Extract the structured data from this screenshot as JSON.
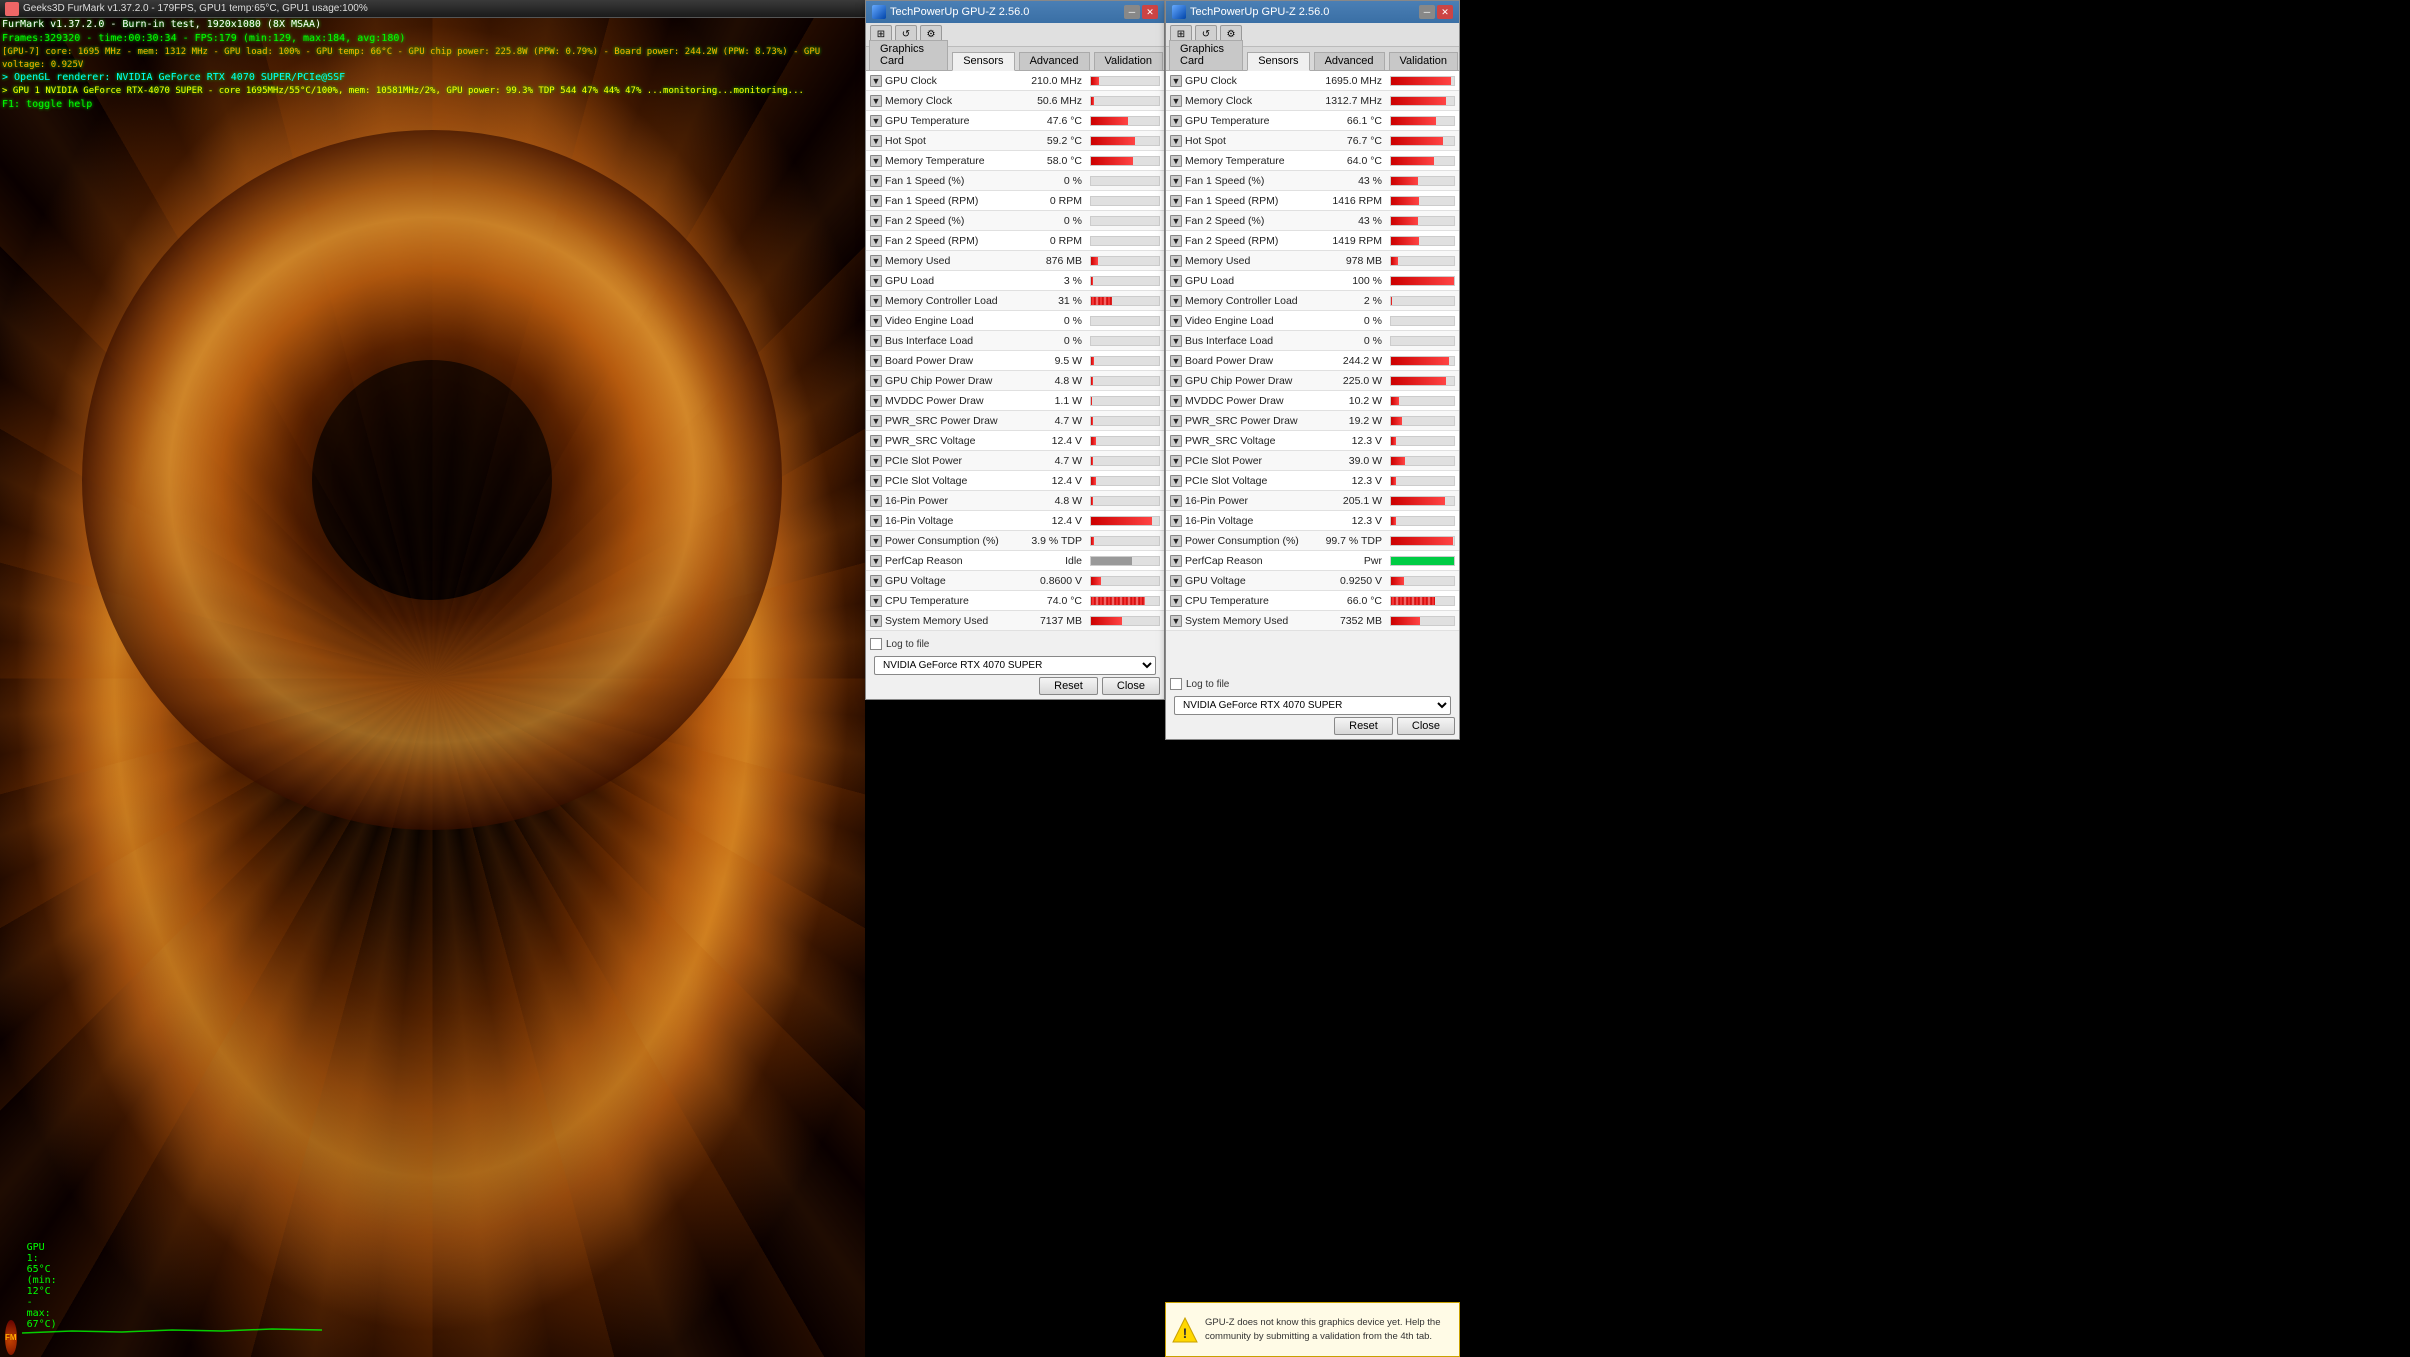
{
  "furmark": {
    "title": "Geeks3D FurMark v1.37.2.0 - 179FPS, GPU1 temp:65°C, GPU1 usage:100%",
    "line1": "FurMark v1.37.2.0 - Burn-in test, 1920x1080 (8X MSAA)",
    "line2": "Frames:329320 - time:00:30:34 - FPS:179 (min:129, max:184, avg:180)",
    "line3": "[GPU-7] core: 1695 MHz - mem: 1312 MHz - GPU load: 100% - GPU temp: 66°C - GPU chip power: 225.8W (PPW: 0.79%) - Board power: 244.2W (PPW: 8.73%) - GPU voltage: 0.925V",
    "line4": "> OpenGL renderer: NVIDIA GeForce RTX 4070 SUPER/PCIe@SSF",
    "line5": "> GPU 1 NVIDIA GeForce RTX-4070 SUPER - core 1695MHz/55°C/100%, mem: 10581MHz/2%, GPU power: 99.3% TDP 544 47% 44% 47% ...monitoring...monitoring...",
    "line6": "F1: toggle help",
    "temp_text": "GPU 1: 65°C (min: 12°C - max: 67°C)"
  },
  "gpuz_left": {
    "title": "TechPowerUp GPU-Z 2.56.0",
    "tabs": [
      "Graphics Card",
      "Sensors",
      "Advanced",
      "Validation"
    ],
    "active_tab": "Sensors",
    "sensors": [
      {
        "name": "GPU Clock",
        "value": "210.0 MHz",
        "bar_pct": 12,
        "bar_type": "red"
      },
      {
        "name": "Memory Clock",
        "value": "50.6 MHz",
        "bar_pct": 4,
        "bar_type": "red"
      },
      {
        "name": "GPU Temperature",
        "value": "47.6 °C",
        "bar_pct": 55,
        "bar_type": "red"
      },
      {
        "name": "Hot Spot",
        "value": "59.2 °C",
        "bar_pct": 65,
        "bar_type": "red"
      },
      {
        "name": "Memory Temperature",
        "value": "58.0 °C",
        "bar_pct": 62,
        "bar_type": "red"
      },
      {
        "name": "Fan 1 Speed (%)",
        "value": "0 %",
        "bar_pct": 0,
        "bar_type": "red"
      },
      {
        "name": "Fan 1 Speed (RPM)",
        "value": "0 RPM",
        "bar_pct": 0,
        "bar_type": "red"
      },
      {
        "name": "Fan 2 Speed (%)",
        "value": "0 %",
        "bar_pct": 0,
        "bar_type": "red"
      },
      {
        "name": "Fan 2 Speed (RPM)",
        "value": "0 RPM",
        "bar_pct": 0,
        "bar_type": "red"
      },
      {
        "name": "Memory Used",
        "value": "876 MB",
        "bar_pct": 10,
        "bar_type": "red"
      },
      {
        "name": "GPU Load",
        "value": "3 %",
        "bar_pct": 3,
        "bar_type": "red"
      },
      {
        "name": "Memory Controller Load",
        "value": "31 %",
        "bar_pct": 31,
        "bar_type": "noise"
      },
      {
        "name": "Video Engine Load",
        "value": "0 %",
        "bar_pct": 0,
        "bar_type": "red"
      },
      {
        "name": "Bus Interface Load",
        "value": "0 %",
        "bar_pct": 0,
        "bar_type": "red"
      },
      {
        "name": "Board Power Draw",
        "value": "9.5 W",
        "bar_pct": 4,
        "bar_type": "red"
      },
      {
        "name": "GPU Chip Power Draw",
        "value": "4.8 W",
        "bar_pct": 3,
        "bar_type": "red"
      },
      {
        "name": "MVDDC Power Draw",
        "value": "1.1 W",
        "bar_pct": 1,
        "bar_type": "red"
      },
      {
        "name": "PWR_SRC Power Draw",
        "value": "4.7 W",
        "bar_pct": 3,
        "bar_type": "red"
      },
      {
        "name": "PWR_SRC Voltage",
        "value": "12.4 V",
        "bar_pct": 8,
        "bar_type": "red"
      },
      {
        "name": "PCIe Slot Power",
        "value": "4.7 W",
        "bar_pct": 3,
        "bar_type": "red"
      },
      {
        "name": "PCIe Slot Voltage",
        "value": "12.4 V",
        "bar_pct": 8,
        "bar_type": "red"
      },
      {
        "name": "16-Pin Power",
        "value": "4.8 W",
        "bar_pct": 3,
        "bar_type": "red"
      },
      {
        "name": "16-Pin Voltage",
        "value": "12.4 V",
        "bar_pct": 90,
        "bar_type": "red"
      },
      {
        "name": "Power Consumption (%)",
        "value": "3.9 % TDP",
        "bar_pct": 4,
        "bar_type": "red"
      },
      {
        "name": "PerfCap Reason",
        "value": "Idle",
        "bar_pct": 60,
        "bar_type": "gray"
      },
      {
        "name": "GPU Voltage",
        "value": "0.8600 V",
        "bar_pct": 15,
        "bar_type": "red"
      },
      {
        "name": "CPU Temperature",
        "value": "74.0 °C",
        "bar_pct": 80,
        "bar_type": "noise"
      },
      {
        "name": "System Memory Used",
        "value": "7137 MB",
        "bar_pct": 45,
        "bar_type": "red"
      }
    ],
    "log_label": "Log to file",
    "btn_reset": "Reset",
    "btn_close": "Close",
    "dropdown": "NVIDIA GeForce RTX 4070 SUPER"
  },
  "gpuz_right": {
    "title": "TechPowerUp GPU-Z 2.56.0",
    "tabs": [
      "Graphics Card",
      "Sensors",
      "Advanced",
      "Validation"
    ],
    "active_tab": "Sensors",
    "sensors": [
      {
        "name": "GPU Clock",
        "value": "1695.0 MHz",
        "bar_pct": 95,
        "bar_type": "red"
      },
      {
        "name": "Memory Clock",
        "value": "1312.7 MHz",
        "bar_pct": 88,
        "bar_type": "red"
      },
      {
        "name": "GPU Temperature",
        "value": "66.1 °C",
        "bar_pct": 72,
        "bar_type": "red"
      },
      {
        "name": "Hot Spot",
        "value": "76.7 °C",
        "bar_pct": 82,
        "bar_type": "red"
      },
      {
        "name": "Memory Temperature",
        "value": "64.0 °C",
        "bar_pct": 68,
        "bar_type": "red"
      },
      {
        "name": "Fan 1 Speed (%)",
        "value": "43 %",
        "bar_pct": 43,
        "bar_type": "red"
      },
      {
        "name": "Fan 1 Speed (RPM)",
        "value": "1416 RPM",
        "bar_pct": 45,
        "bar_type": "red"
      },
      {
        "name": "Fan 2 Speed (%)",
        "value": "43 %",
        "bar_pct": 43,
        "bar_type": "red"
      },
      {
        "name": "Fan 2 Speed (RPM)",
        "value": "1419 RPM",
        "bar_pct": 45,
        "bar_type": "red"
      },
      {
        "name": "Memory Used",
        "value": "978 MB",
        "bar_pct": 11,
        "bar_type": "red"
      },
      {
        "name": "GPU Load",
        "value": "100 %",
        "bar_pct": 100,
        "bar_type": "red"
      },
      {
        "name": "Memory Controller Load",
        "value": "2 %",
        "bar_pct": 2,
        "bar_type": "red"
      },
      {
        "name": "Video Engine Load",
        "value": "0 %",
        "bar_pct": 0,
        "bar_type": "red"
      },
      {
        "name": "Bus Interface Load",
        "value": "0 %",
        "bar_pct": 0,
        "bar_type": "red"
      },
      {
        "name": "Board Power Draw",
        "value": "244.2 W",
        "bar_pct": 92,
        "bar_type": "red"
      },
      {
        "name": "GPU Chip Power Draw",
        "value": "225.0 W",
        "bar_pct": 88,
        "bar_type": "red"
      },
      {
        "name": "MVDDC Power Draw",
        "value": "10.2 W",
        "bar_pct": 12,
        "bar_type": "red"
      },
      {
        "name": "PWR_SRC Power Draw",
        "value": "19.2 W",
        "bar_pct": 18,
        "bar_type": "red"
      },
      {
        "name": "PWR_SRC Voltage",
        "value": "12.3 V",
        "bar_pct": 8,
        "bar_type": "red"
      },
      {
        "name": "PCIe Slot Power",
        "value": "39.0 W",
        "bar_pct": 22,
        "bar_type": "red"
      },
      {
        "name": "PCIe Slot Voltage",
        "value": "12.3 V",
        "bar_pct": 8,
        "bar_type": "red"
      },
      {
        "name": "16-Pin Power",
        "value": "205.1 W",
        "bar_pct": 85,
        "bar_type": "red"
      },
      {
        "name": "16-Pin Voltage",
        "value": "12.3 V",
        "bar_pct": 8,
        "bar_type": "red"
      },
      {
        "name": "Power Consumption (%)",
        "value": "99.7 % TDP",
        "bar_pct": 98,
        "bar_type": "red"
      },
      {
        "name": "PerfCap Reason",
        "value": "Pwr",
        "bar_pct": 100,
        "bar_type": "green"
      },
      {
        "name": "GPU Voltage",
        "value": "0.9250 V",
        "bar_pct": 20,
        "bar_type": "red"
      },
      {
        "name": "CPU Temperature",
        "value": "66.0 °C",
        "bar_pct": 70,
        "bar_type": "noise"
      },
      {
        "name": "System Memory Used",
        "value": "7352 MB",
        "bar_pct": 46,
        "bar_type": "red"
      }
    ],
    "log_label": "Log to file",
    "btn_reset": "Reset",
    "btn_close": "Close",
    "dropdown": "NVIDIA GeForce RTX 4070 SUPER",
    "notification": "GPU-Z does not know this graphics device yet.\nHelp the community by submitting a validation from the 4th tab."
  }
}
